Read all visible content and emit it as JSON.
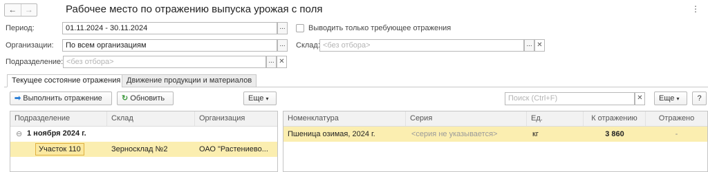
{
  "header": {
    "title": "Рабочее место по отражению выпуска урожая с поля",
    "more_icon": "⋮"
  },
  "filters": {
    "period_label": "Период:",
    "period_value": "01.11.2024 - 30.11.2024",
    "only_required_label": "Выводить только требующее отражения",
    "org_label": "Организации:",
    "org_value": "По всем организациям",
    "warehouse_label": "Склад:",
    "warehouse_placeholder": "<без отбора>",
    "division_label": "Подразделение:",
    "division_placeholder": "<без отбора>"
  },
  "tabs": [
    {
      "label": "Текущее состояние отражения"
    },
    {
      "label": "Движение продукции и материалов"
    }
  ],
  "toolbar_left": {
    "execute_label": "Выполнить отражение",
    "refresh_label": "Обновить",
    "more_label": "Еще"
  },
  "toolbar_right": {
    "search_placeholder": "Поиск (Ctrl+F)",
    "more_label": "Еще",
    "help_label": "?"
  },
  "left_table": {
    "columns": [
      "Подразделение",
      "Склад",
      "Организация"
    ],
    "group": {
      "toggle": "⊖",
      "label": "1 ноября 2024 г."
    },
    "rows": [
      {
        "division": "Участок 110",
        "warehouse": "Зерносклад №2",
        "organization": "ОАО \"Растениево..."
      }
    ]
  },
  "right_table": {
    "columns": [
      "Номенклатура",
      "Серия",
      "Ед.",
      "К отражению",
      "Отражено"
    ],
    "rows": [
      {
        "item": "Пшеница озимая, 2024 г.",
        "series": "<серия не указывается>",
        "unit": "кг",
        "to_reflect": "3 860",
        "reflected": "-"
      }
    ]
  },
  "colors": {
    "selected_row": "#fbeeb0",
    "current_cell_border": "#e0b040",
    "accent_green": "#3f9a3f",
    "accent_blue": "#2a7ed6"
  }
}
